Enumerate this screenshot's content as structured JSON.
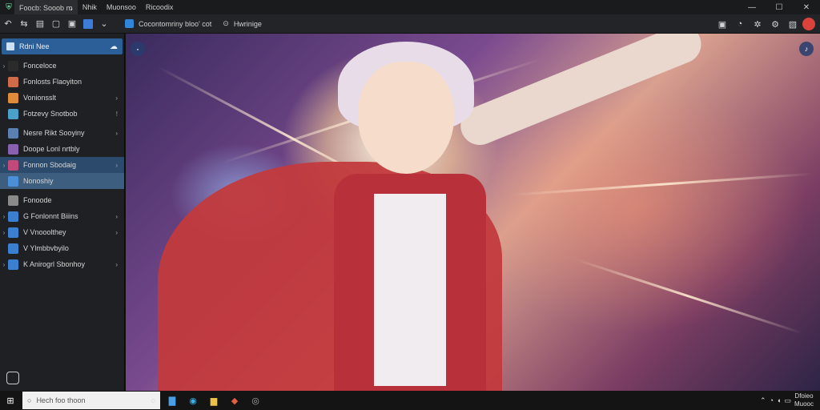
{
  "titlebar": {
    "tabs": [
      {
        "label": "Foocb: Sooob ꬺ"
      },
      {
        "label": "Nhik"
      },
      {
        "label": "Muonsoo"
      },
      {
        "label": "Ricoodix"
      }
    ],
    "controls": {
      "minimize": "—",
      "maximize": "☐",
      "close": "✕"
    }
  },
  "toolbar": {
    "address_text": "Cocontomriny bloo' cot",
    "secondary_text": "Hwrinige"
  },
  "sidebar": {
    "header": "Rdni Nee",
    "items": [
      {
        "label": "Fonceloce",
        "caret": "›",
        "icon_color": "#2b2b2b",
        "end": ""
      },
      {
        "label": "Fonlosts Flaoyiton",
        "caret": "",
        "icon_color": "#d06b4a",
        "end": ""
      },
      {
        "label": "Vonionsslt",
        "caret": "",
        "icon_color": "#e08b3a",
        "end": "›"
      },
      {
        "label": "Fotzevy Snotbob",
        "caret": "",
        "icon_color": "#4aa0c8",
        "end": "!"
      },
      {
        "label": "Nesre Rikt Sooyiny",
        "caret": "",
        "icon_color": "#5a7fb0",
        "end": "›"
      },
      {
        "label": "Doope Lonl nrtbly",
        "caret": "",
        "icon_color": "#8a60b0",
        "end": ""
      },
      {
        "label": "Fonnon Sbodaig",
        "caret": "›",
        "icon_color": "#c24a7a",
        "end": "›",
        "state": "sel"
      },
      {
        "label": "Nonoshiy",
        "caret": "",
        "icon_color": "#4a8fd8",
        "end": "",
        "state": "sel2"
      },
      {
        "label": "Fonoode",
        "caret": "",
        "icon_color": "#8a8a8a",
        "end": ""
      },
      {
        "label": "G Fonlonnt Biiins",
        "caret": "›",
        "icon_color": "#3a7fd0",
        "end": "›"
      },
      {
        "label": "V Vnooolthey",
        "caret": "›",
        "icon_color": "#3a7fd0",
        "end": "›"
      },
      {
        "label": "V Ylmbbvbyilo",
        "caret": "",
        "icon_color": "#3a7fd0",
        "end": ""
      },
      {
        "label": "K Anirogrl Sbonhoy",
        "caret": "›",
        "icon_color": "#3a7fd0",
        "end": "›"
      }
    ]
  },
  "taskbar": {
    "search_placeholder": "Hech foo thoon",
    "clock_time": "Dfoieo",
    "clock_date": "Muooc"
  },
  "icons": {
    "app": "shield-icon",
    "back": "back-icon",
    "sidebar_toggle": "sidebar-icon"
  },
  "colors": {
    "accent": "#2c5f97",
    "selected": "#2c4a6b",
    "profile": "#d9433c"
  }
}
